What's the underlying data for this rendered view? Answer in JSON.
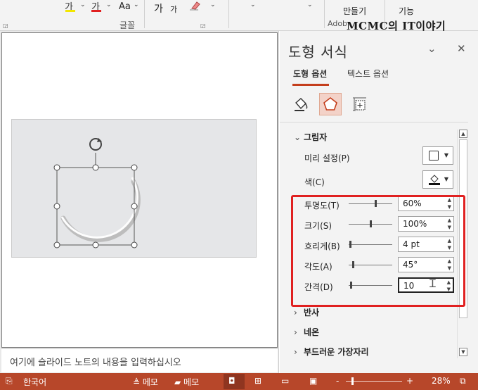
{
  "ribbon": {
    "font_highlight_icon": "가",
    "font_color_icon": "가",
    "case_label": "Aa",
    "grow_font": "가",
    "shrink_font": "가",
    "group_font": "글꼴",
    "btn_make": "만들기",
    "btn_feature": "기능",
    "addon_fragment": "Adob",
    "colors": {
      "highlight": "#f2e600",
      "font_color": "#e02020"
    }
  },
  "watermark": "MCMC의 IT이야기",
  "slide_area": {
    "notes_placeholder": "여기에 슬라이드 노트의 내용을 입력하십시오"
  },
  "pane": {
    "title": "도형 서식",
    "collapse_icon": "chevron-down-icon",
    "close_icon": "close-icon",
    "tabs": [
      {
        "label": "도형 옵션",
        "active": true
      },
      {
        "label": "텍스트 옵션",
        "active": false
      }
    ],
    "icon_tabs": [
      "fill-line-icon",
      "effects-pentagon-icon",
      "size-properties-icon"
    ],
    "shadow": {
      "header": "그림자",
      "preset_label": "미리 설정(P)",
      "color_label": "색(C)",
      "properties": [
        {
          "label": "투명도(T)",
          "value": "60%",
          "slider": 0.6
        },
        {
          "label": "크기(S)",
          "value": "100%",
          "slider": 0.5
        },
        {
          "label": "흐리게(B)",
          "value": "4 pt",
          "slider": 0.04
        },
        {
          "label": "각도(A)",
          "value": "45°",
          "slider": 0.125
        },
        {
          "label": "간격(D)",
          "value": "10",
          "slider": 0.05
        }
      ]
    },
    "sections": [
      {
        "label": "반사"
      },
      {
        "label": "네온"
      },
      {
        "label": "부드러운 가장자리"
      }
    ]
  },
  "status": {
    "language": "한국어",
    "notes": "메모",
    "comments": "메모",
    "zoom": "28%",
    "minus": "-",
    "plus": "+"
  },
  "colors": {
    "accent": "#c43e1c",
    "status_bar": "#b7472a",
    "highlight_box": "#e02020"
  }
}
